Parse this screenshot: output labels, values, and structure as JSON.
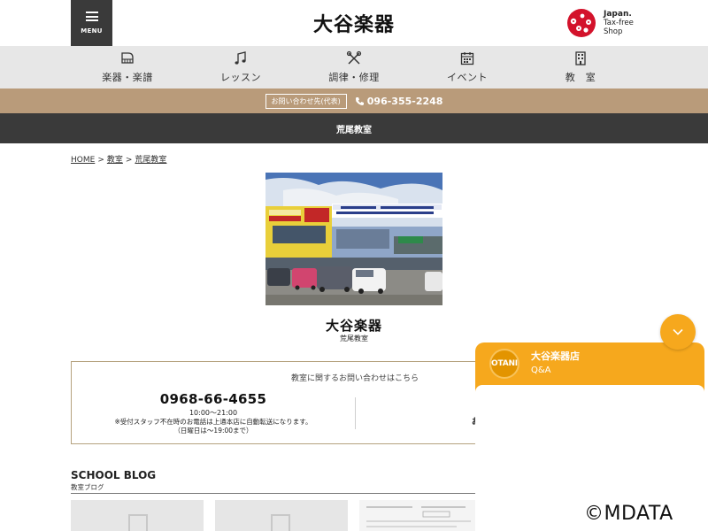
{
  "header": {
    "menu_label": "MENU",
    "logo_text": "大谷楽器",
    "taxfree": {
      "line1": "Japan.",
      "line2": "Tax-free",
      "line3": "Shop"
    }
  },
  "nav": {
    "items": [
      {
        "label": "楽器・楽譜",
        "icon": "piano-icon"
      },
      {
        "label": "レッスン",
        "icon": "music-note-icon"
      },
      {
        "label": "調律・修理",
        "icon": "tools-icon"
      },
      {
        "label": "イベント",
        "icon": "calendar-icon"
      },
      {
        "label": "教　室",
        "icon": "building-icon"
      }
    ]
  },
  "contact": {
    "tag": "お問い合わせ先(代表)",
    "phone": "096-355-2248"
  },
  "page_title": "荒尾教室",
  "breadcrumb": {
    "home": "HOME",
    "sep": ">",
    "classroom": "教室",
    "current": "荒尾教室"
  },
  "store": {
    "logo_text": "大谷楽器",
    "name": "荒尾教室"
  },
  "inquiry": {
    "title": "教室に関するお問い合わせはこちら",
    "phone": "0968-66-4655",
    "hours": "10:00～21:00",
    "note1": "※受付スタッフ不在時のお電話は上通本店に自動転送になります。",
    "note2": "（日曜日は～19:00まで）",
    "right_text": "お"
  },
  "blog": {
    "title": "SCHOOL BLOG",
    "subtitle": "教室ブログ"
  },
  "chat": {
    "avatar_text": "OTANI",
    "name": "大谷楽器店",
    "subtitle": "Q&A"
  },
  "watermark": "©MDATA",
  "colors": {
    "dark_bar": "#3a3a3a",
    "contact_bar": "#b99b7a",
    "nav_bg": "#e7e7e7",
    "chat_orange": "#f6a81d",
    "inquiry_border": "#b5a27e"
  }
}
